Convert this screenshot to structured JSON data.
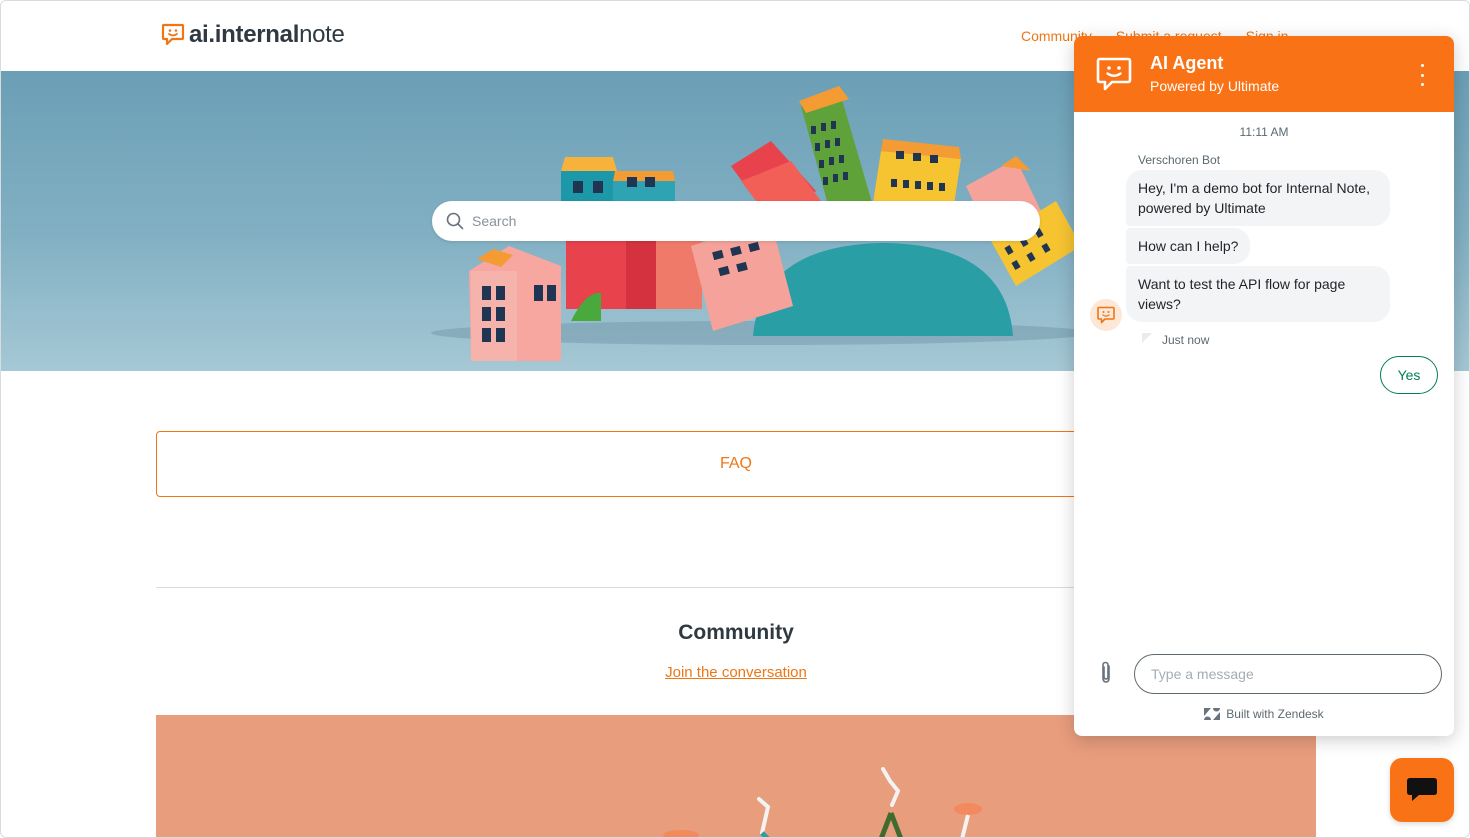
{
  "header": {
    "logo_bold": "ai.internal",
    "logo_light": "note",
    "nav": [
      "Community",
      "Submit a request",
      "Sign in"
    ]
  },
  "hero": {
    "search_placeholder": "Search"
  },
  "main": {
    "faq_label": "FAQ",
    "community_title": "Community",
    "community_link": "Join the conversation"
  },
  "chat": {
    "title": "AI Agent",
    "subtitle": "Powered by Ultimate",
    "time": "11:11 AM",
    "sender": "Verschoren Bot",
    "messages": [
      "Hey, I'm a demo bot for Internal Note, powered by Ultimate",
      "How can I help?",
      "Want to test the API flow for page views?"
    ],
    "status": "Just now",
    "reply_option": "Yes",
    "input_placeholder": "Type a message",
    "footer": "Built with Zendesk"
  },
  "colors": {
    "brand": "#f97316",
    "link": "#ef7614",
    "success": "#037f52"
  },
  "icons": [
    "smile-chat-icon",
    "search-icon",
    "more-vertical-icon",
    "paperclip-icon",
    "zendesk-icon",
    "chat-bubble-icon"
  ]
}
